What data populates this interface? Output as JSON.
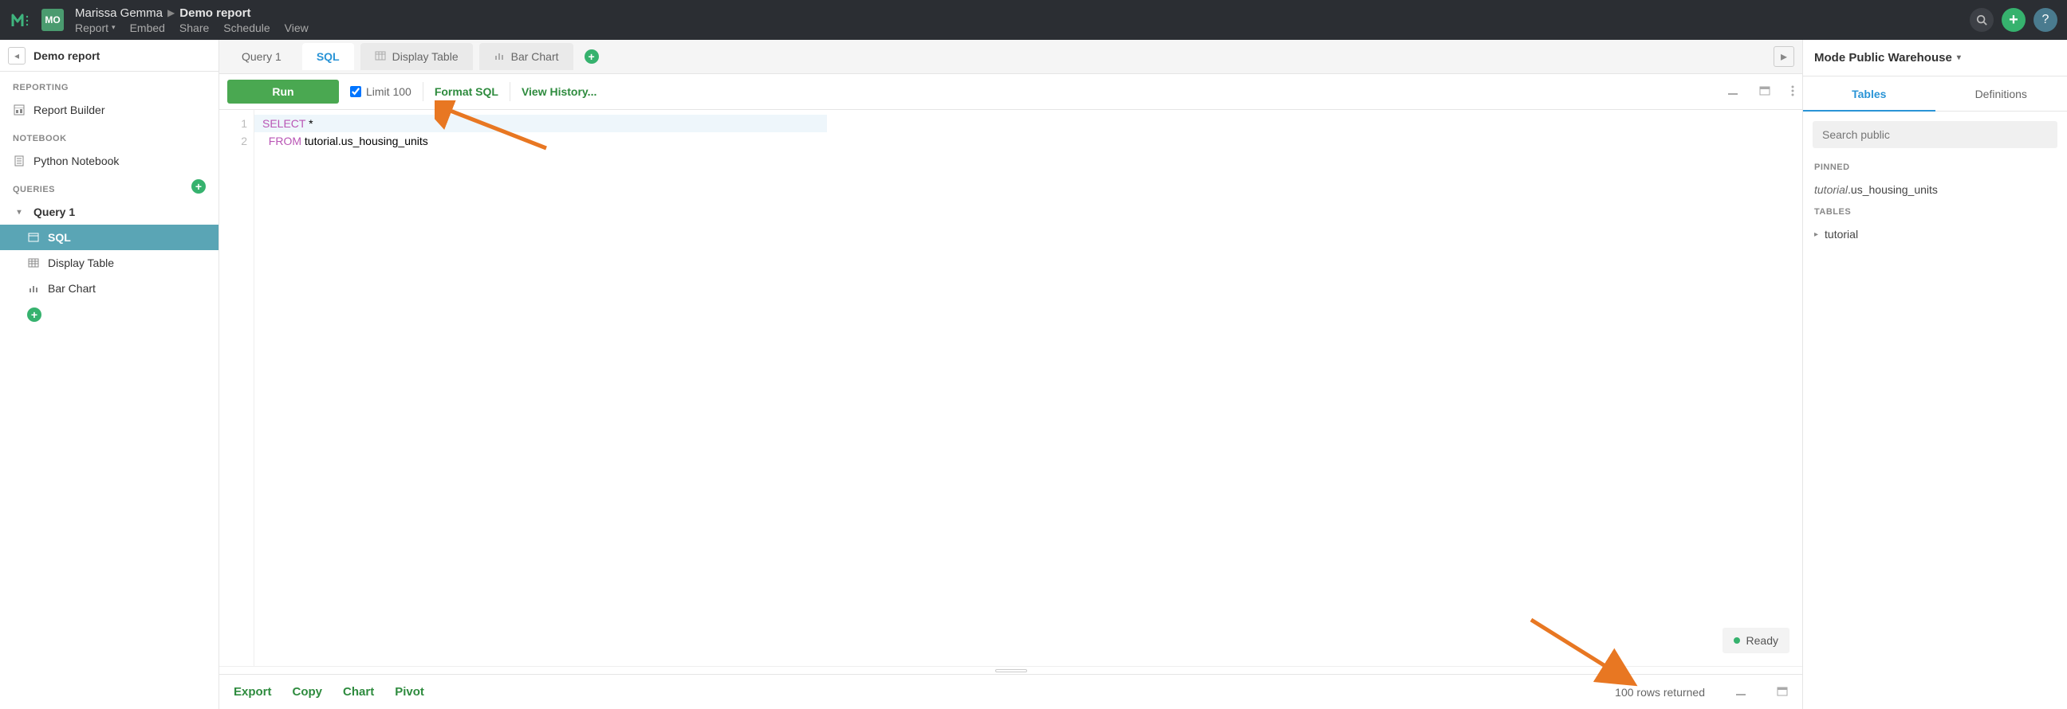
{
  "topbar": {
    "avatar_initials": "MO",
    "user_name": "Marissa Gemma",
    "report_name": "Demo report",
    "menu": {
      "report": "Report",
      "embed": "Embed",
      "share": "Share",
      "schedule": "Schedule",
      "view": "View"
    }
  },
  "sidebar": {
    "back_title": "Demo report",
    "sections": {
      "reporting": "REPORTING",
      "notebook": "NOTEBOOK",
      "queries": "QUERIES"
    },
    "items": {
      "report_builder": "Report Builder",
      "python_notebook": "Python Notebook",
      "query1": "Query 1",
      "sql": "SQL",
      "display_table": "Display Table",
      "bar_chart": "Bar Chart"
    }
  },
  "tabs": {
    "query1": "Query 1",
    "sql": "SQL",
    "display_table": "Display Table",
    "bar_chart": "Bar Chart"
  },
  "toolbar": {
    "run": "Run",
    "limit": "Limit 100",
    "format_sql": "Format SQL",
    "view_history": "View History..."
  },
  "editor": {
    "lines": {
      "l1": {
        "num": "1",
        "kw": "SELECT",
        "rest": " *"
      },
      "l2": {
        "num": "2",
        "kw": "FROM",
        "rest": " tutorial.us_housing_units"
      }
    }
  },
  "status": {
    "ready": "Ready"
  },
  "bottombar": {
    "export": "Export",
    "copy": "Copy",
    "chart": "Chart",
    "pivot": "Pivot",
    "rows_returned": "100 rows returned"
  },
  "rightpanel": {
    "warehouse": "Mode Public Warehouse",
    "tabs": {
      "tables": "Tables",
      "definitions": "Definitions"
    },
    "search_placeholder": "Search public",
    "pinned_label": "PINNED",
    "pinned_item_prefix": "tutorial",
    "pinned_item_rest": ".us_housing_units",
    "tables_label": "TABLES",
    "tree_item": "tutorial"
  }
}
